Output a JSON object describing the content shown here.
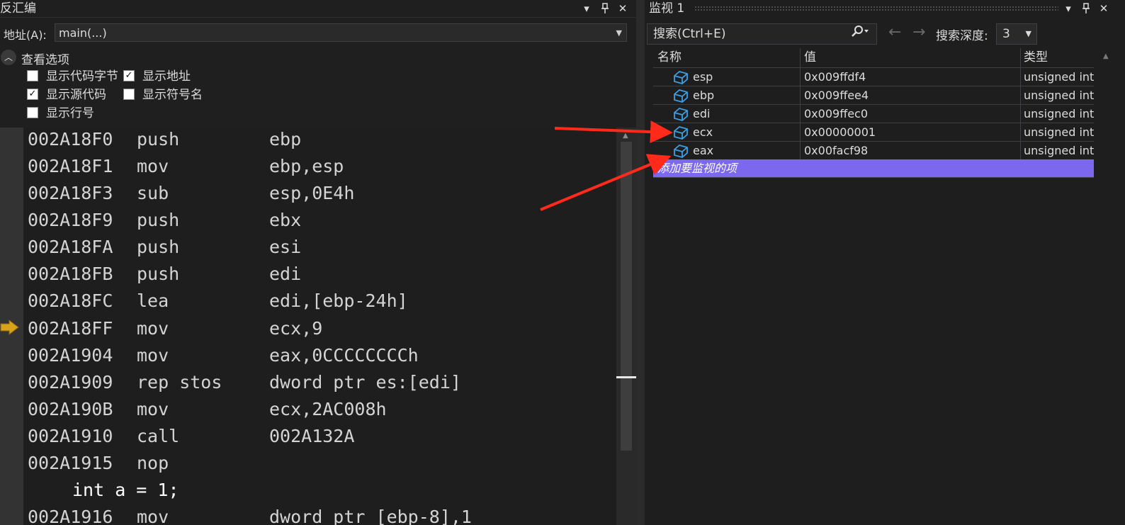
{
  "disassembly": {
    "title": "反汇编",
    "address_label": "地址(A):",
    "address_value": "main(...)",
    "options_title": "查看选项",
    "options": [
      {
        "label": "显示代码字节",
        "checked": false
      },
      {
        "label": "显示地址",
        "checked": true
      },
      {
        "label": "显示源代码",
        "checked": true
      },
      {
        "label": "显示符号名",
        "checked": false
      },
      {
        "label": "显示行号",
        "checked": false
      }
    ],
    "lines": [
      {
        "addr": "002A18F0",
        "mnem": "push",
        "ops": "ebp"
      },
      {
        "addr": "002A18F1",
        "mnem": "mov",
        "ops": "ebp,esp"
      },
      {
        "addr": "002A18F3",
        "mnem": "sub",
        "ops": "esp,0E4h"
      },
      {
        "addr": "002A18F9",
        "mnem": "push",
        "ops": "ebx"
      },
      {
        "addr": "002A18FA",
        "mnem": "push",
        "ops": "esi"
      },
      {
        "addr": "002A18FB",
        "mnem": "push",
        "ops": "edi"
      },
      {
        "addr": "002A18FC",
        "mnem": "lea",
        "ops": "edi,[ebp-24h]"
      },
      {
        "addr": "002A18FF",
        "mnem": "mov",
        "ops": "ecx,9"
      },
      {
        "addr": "002A1904",
        "mnem": "mov",
        "ops": "eax,0CCCCCCCCh"
      },
      {
        "addr": "002A1909",
        "mnem": "rep stos",
        "ops": "dword ptr es:[edi]"
      },
      {
        "addr": "002A190B",
        "mnem": "mov",
        "ops": "ecx,2AC008h"
      },
      {
        "addr": "002A1910",
        "mnem": "call",
        "ops": "002A132A"
      },
      {
        "addr": "002A1915",
        "mnem": "nop",
        "ops": ""
      }
    ],
    "source_line": "int a = 1;",
    "last_line": {
      "addr": "002A1916",
      "mnem": "mov",
      "ops": "dword ptr [ebp-8],1"
    }
  },
  "watch": {
    "title": "监视 1",
    "search_placeholder": "搜索(Ctrl+E)",
    "search_icon": "search-icon",
    "depth_label": "搜索深度:",
    "depth_value": "3",
    "columns": {
      "name": "名称",
      "value": "值",
      "type": "类型"
    },
    "rows": [
      {
        "name": "esp",
        "value": "0x009ffdf4",
        "type": "unsigned int"
      },
      {
        "name": "ebp",
        "value": "0x009ffee4",
        "type": "unsigned int"
      },
      {
        "name": "edi",
        "value": "0x009ffec0",
        "type": "unsigned int"
      },
      {
        "name": "ecx",
        "value": "0x00000001",
        "type": "unsigned int"
      },
      {
        "name": "eax",
        "value": "0x00facf98",
        "type": "unsigned int"
      }
    ],
    "add_item_text": "添加要监视的项",
    "add_row_color": "#7b68ee"
  },
  "colors": {
    "background": "#1f1f1f",
    "annotation_arrow": "#ff2a1a",
    "instruction_pointer": "#d8a21b",
    "variable_icon": "#3aa0e6"
  }
}
